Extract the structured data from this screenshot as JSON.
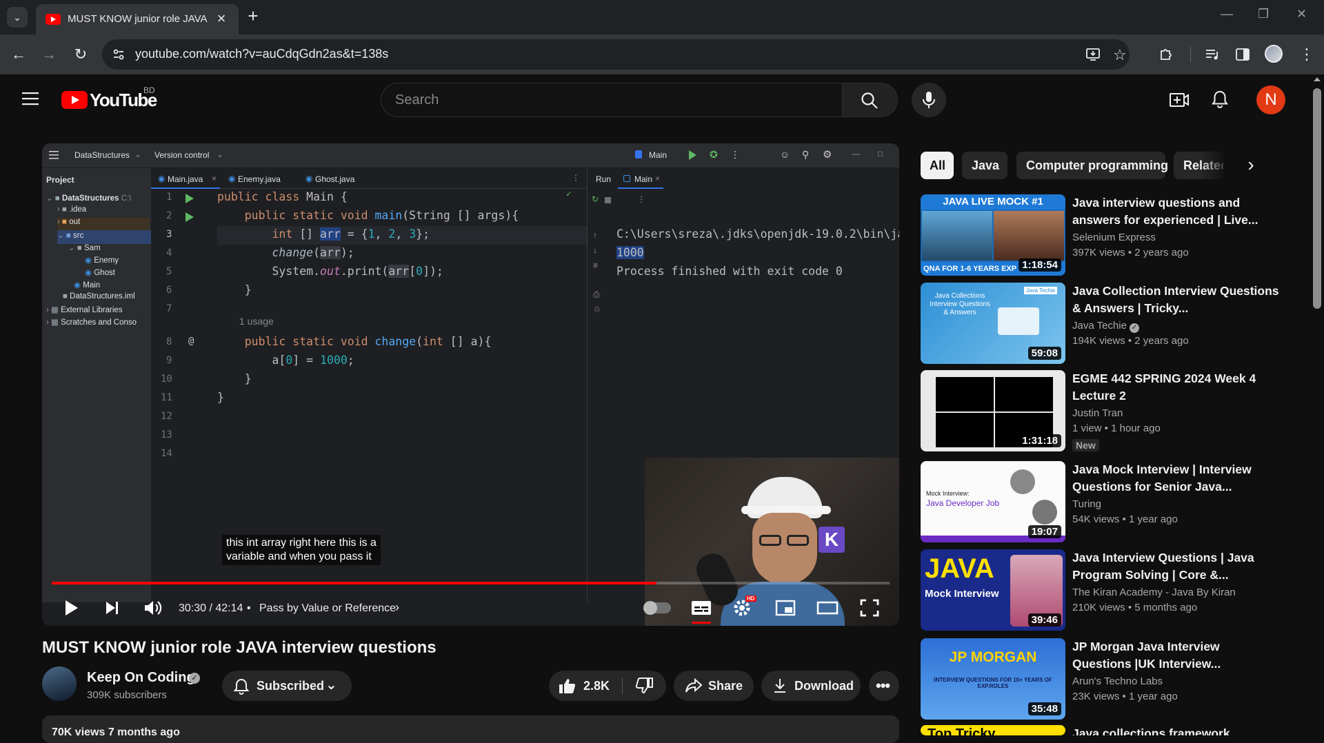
{
  "browser": {
    "tab_title": "MUST KNOW junior role JAVA interview questions",
    "url": "youtube.com/watch?v=auCdqGdn2as&t=138s"
  },
  "youtube": {
    "logo_text": "YouTube",
    "region": "BD",
    "search_placeholder": "Search",
    "avatar_letter": "N"
  },
  "ide": {
    "project_name": "DataStructures",
    "version_control": "Version control",
    "run_config": "Main",
    "project_label": "Project",
    "tree": [
      {
        "label": "DataStructures",
        "suffix": "C:\\"
      },
      {
        "label": ".idea"
      },
      {
        "label": "out"
      },
      {
        "label": "src"
      },
      {
        "label": "Sam"
      },
      {
        "label": "Enemy"
      },
      {
        "label": "Ghost"
      },
      {
        "label": "Main"
      },
      {
        "label": "DataStructures.iml"
      },
      {
        "label": "External Libraries"
      },
      {
        "label": "Scratches and Conso"
      }
    ],
    "tabs": [
      "Main.java",
      "Enemy.java",
      "Ghost.java"
    ],
    "line_numbers": [
      "1",
      "2",
      "3",
      "4",
      "5",
      "6",
      "7",
      "8",
      "9",
      "10",
      "11",
      "12",
      "13",
      "14"
    ],
    "usage_hint": "1 usage",
    "run_label": "Run",
    "run_tab": "Main",
    "console": [
      "C:\\Users\\sreza\\.jdks\\openjdk-19.0.2\\bin\\ja",
      "1000",
      "Process finished with exit code 0"
    ]
  },
  "player": {
    "subtitle_line1": "this int array right here this is a",
    "subtitle_line2": "variable and when you pass it",
    "time": "30:30 / 42:14",
    "chapter": "Pass by Value or Reference",
    "progress_fraction": 0.722,
    "hd_badge": "HD"
  },
  "video": {
    "title": "MUST KNOW junior role JAVA interview questions",
    "channel": "Keep On Coding",
    "subscribers": "309K subscribers",
    "subscribe_label": "Subscribed",
    "likes": "2.8K",
    "share_label": "Share",
    "download_label": "Download",
    "stats": "70K views  7 months ago"
  },
  "chips": [
    "All",
    "Java",
    "Computer programming",
    "Related"
  ],
  "recommendations": [
    {
      "title": "Java interview questions and answers for experienced | Live...",
      "channel": "Selenium Express",
      "meta": "397K views • 2 years ago",
      "duration": "1:18:54",
      "thumb_text_top": "JAVA LIVE MOCK #1",
      "thumb_text_bottom": "QNA FOR 1-6 YEARS EXP"
    },
    {
      "title": "Java Collection Interview Questions & Answers | Tricky...",
      "channel": "Java Techie",
      "meta": "194K views • 2 years ago",
      "duration": "59:08",
      "thumb_text_top": "Java Collections Interview Questions & Answers",
      "thumb_text_bottom": "Java Techie"
    },
    {
      "title": "EGME 442 SPRING 2024 Week 4 Lecture 2",
      "channel": "Justin Tran",
      "meta": "1 view • 1 hour ago",
      "duration": "1:31:18",
      "badge": "New"
    },
    {
      "title": "Java Mock Interview | Interview Questions for Senior Java...",
      "channel": "Turing",
      "meta": "54K views • 1 year ago",
      "duration": "19:07",
      "thumb_text_top": "Mock Interview:",
      "thumb_text_bottom": "Java Developer Job"
    },
    {
      "title": "Java Interview Questions | Java Program Solving | Core &...",
      "channel": "The Kiran Academy - Java By Kiran",
      "meta": "210K views • 5 months ago",
      "duration": "39:46",
      "thumb_text_top": "JAVA",
      "thumb_text_bottom": "Mock Interview"
    },
    {
      "title": "JP Morgan Java Interview Questions |UK Interview...",
      "channel": "Arun's Techno Labs",
      "meta": "23K views • 1 year ago",
      "duration": "35:48",
      "thumb_text_top": "JP MORGAN",
      "thumb_text_bottom": "INTERVIEW QUESTIONS FOR 10+ YEARS OF EXP.ROLES"
    },
    {
      "title": "Java collections framework",
      "channel": "",
      "meta": "",
      "duration": "",
      "thumb_text_top": "Top Tricky"
    }
  ]
}
